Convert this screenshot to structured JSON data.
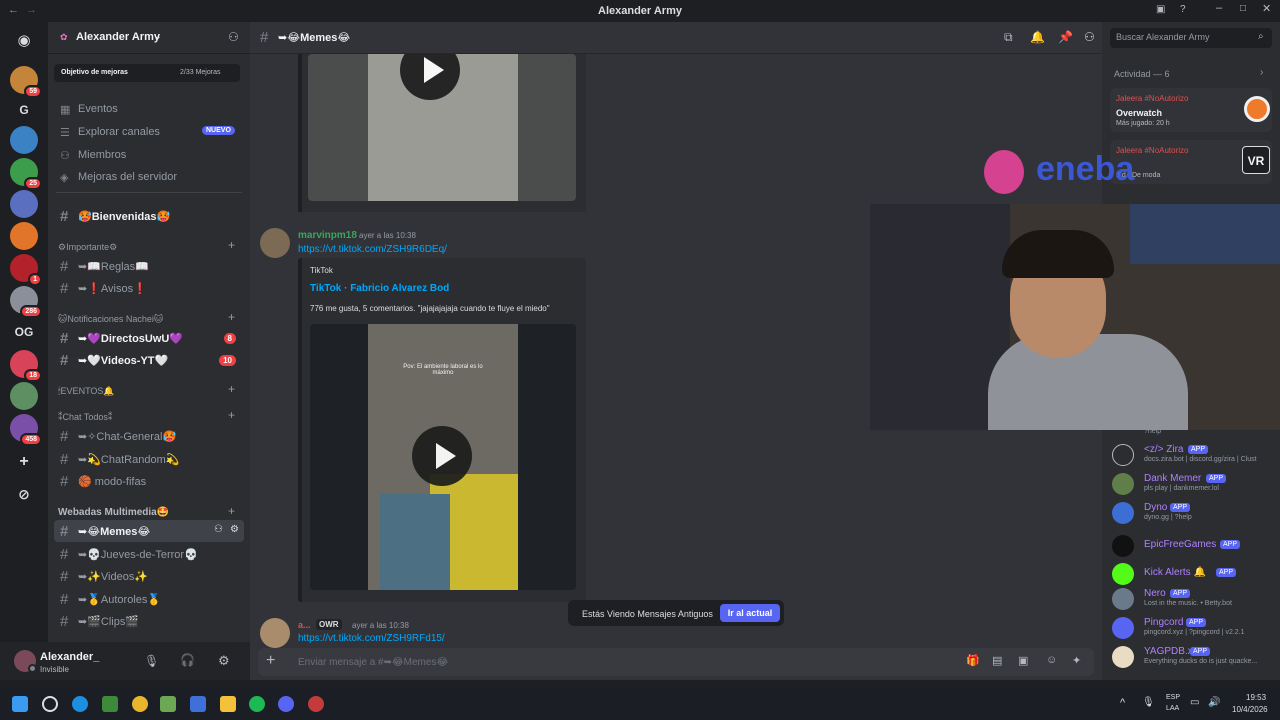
{
  "window": {
    "title": "Alexander Army"
  },
  "server": {
    "name": "Alexander Army",
    "boost": {
      "label": "Objetivo de mejoras",
      "progress": "2/33 Mejoras"
    },
    "nav": [
      "Eventos",
      "Explorar canales",
      "Miembros",
      "Mejoras del servidor"
    ],
    "nav_badge": "NUEVO",
    "channels": [
      {
        "name": "🥵Bienvenidas🥵",
        "bold": true
      },
      {
        "category": "⚙Importante⚙"
      },
      {
        "name": "➥📖Reglas📖"
      },
      {
        "name": "➥❗Avisos❗"
      },
      {
        "category": "🐱Notificaciones Nachei🐱"
      },
      {
        "name": "➥💜DirectosUwU💜",
        "badge": "8",
        "bold": true
      },
      {
        "name": "➥🤍Videos-YT🤍",
        "badge": "10",
        "bold": true
      },
      {
        "category": "🕯EVENTOS🔔"
      },
      {
        "category": "⁑Chat Todos⁑"
      },
      {
        "name": "➥✧Chat-General🥵"
      },
      {
        "name": "➥💫ChatRandom💫"
      },
      {
        "name": "🏀 modo-fifas"
      },
      {
        "category": "Webadas Multimedia🤩"
      },
      {
        "name": "➥😂Memes😂",
        "selected": true
      },
      {
        "name": "➥💀Jueves-de-Terror💀"
      },
      {
        "name": "➥✨Videos✨"
      },
      {
        "name": "➥🥇Autoroles🥇"
      },
      {
        "name": "➥🎬Clips🎬"
      }
    ],
    "guild_badges": [
      "59",
      "25",
      "1",
      "286",
      "18",
      "458"
    ],
    "guild_letters": [
      "G",
      "OG"
    ]
  },
  "user": {
    "name": "Alexander_",
    "status": "Invisible"
  },
  "channel": {
    "title": "➥😂Memes😂",
    "composer_placeholder": "Enviar mensaje a #➥😂Memes😂"
  },
  "messages": [
    {
      "author": "marvinpm18",
      "time": "ayer a las 10:38",
      "link": "https://vt.tiktok.com/ZSH9R6DEq/",
      "embed_provider": "TikTok",
      "embed_title": "TikTok · Fabricio Alvarez Bod",
      "embed_desc": "776 me gusta, 5 comentarios. \"jajajajajaja cuando te fluye el miedo\"",
      "embed_overlay": "Pov: El ambiente laboral es lo máximo"
    },
    {
      "author": "a...",
      "tag": "OWR",
      "time": "ayer a las 10:38",
      "link": "https://vt.tiktok.com/ZSH9RFd15/"
    }
  ],
  "jump_bar": {
    "text": "Estás Viendo Mensajes Antiguos",
    "button": "Ir al actual"
  },
  "search": {
    "placeholder": "Buscar Alexander Army"
  },
  "activity": {
    "header": "Actividad — 6",
    "items": [
      {
        "user": "Jaleera #NoAutorizo",
        "game": "Overwatch",
        "sub": "Más jugado: 20 h"
      },
      {
        "user": "Jaleera #NoAutorizo",
        "game": "VR",
        "sub": "3 d · De moda"
      }
    ]
  },
  "members": [
    {
      "name": "<z/> Zira",
      "sub": "docs.zira.bot | discord.gg/zira | Clust",
      "color": "#b080ff",
      "app": "APP"
    },
    {
      "name": "Dank Memer",
      "sub": "pls play | dankmemer.lol",
      "color": "#b080ff",
      "app": "APP"
    },
    {
      "name": "Dyno",
      "sub": "dyno.gg | ?help",
      "color": "#b080ff",
      "app": "APP"
    },
    {
      "name": "EpicFreeGames",
      "sub": "",
      "color": "#b080ff",
      "app": "APP"
    },
    {
      "name": "Kick Alerts 🔔",
      "sub": "",
      "color": "#b080ff",
      "app": "APP"
    },
    {
      "name": "Nero",
      "sub": "Lost in the music. • Betty.bot",
      "color": "#b080ff",
      "app": "APP"
    },
    {
      "name": "Pingcord",
      "sub": "pingcord.xyz | ?pingcord | v2.2.1",
      "color": "#b080ff",
      "app": "APP"
    },
    {
      "name": "YAGPDB.xyz",
      "sub": "Everything ducks do is just quacke...",
      "color": "#b080ff",
      "app": "APP"
    }
  ],
  "members_top_sub": "?help",
  "overlay": {
    "sponsor": "eneba"
  },
  "taskbar": {
    "lang": "ESP",
    "lang2": "LAA",
    "time": "19:53",
    "date": "10/4/2026"
  }
}
